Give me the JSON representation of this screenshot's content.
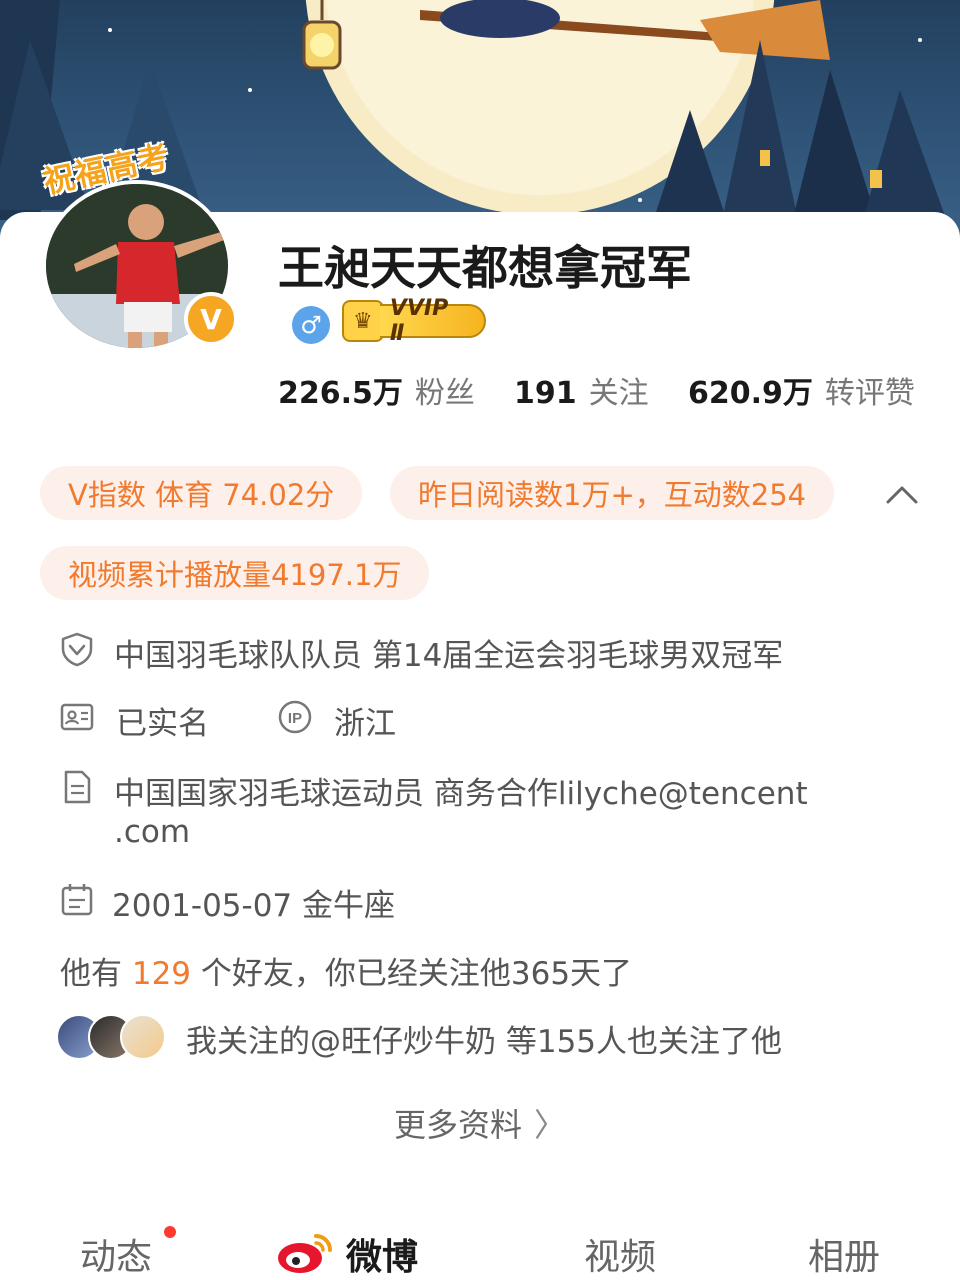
{
  "profile": {
    "avatar_caption": "祝福高考",
    "verified_badge": "V",
    "name": "王昶天天都想拿冠军",
    "gender_icon": "male-symbol-icon",
    "gender_symbol": "♂",
    "vip_label": "VVIP Ⅱ"
  },
  "stats": {
    "fans": {
      "value": "226.5万",
      "label": "粉丝"
    },
    "following": {
      "value": "191",
      "label": "关注"
    },
    "interactions": {
      "value": "620.9万",
      "label": "转评赞"
    }
  },
  "pills": {
    "v_index": "V指数 体育 74.02分",
    "yesterday": "昨日阅读数1万+，互动数254",
    "video": "视频累计播放量4197.1万"
  },
  "info": {
    "title": "中国羽毛球队队员 第14届全运会羽毛球男双冠军",
    "real_name": "已实名",
    "ip_label": "IP",
    "ip_location": "浙江",
    "bio_line1": "中国国家羽毛球运动员 商务合作lilyche@tencent",
    "bio_line2": ".com",
    "birthday": "2001-05-07 金牛座"
  },
  "friends": {
    "prefix": "他有",
    "count": "129",
    "suffix": "个好友，你已经关注他365天了"
  },
  "mutual": {
    "text": "我关注的@旺仔炒牛奶 等155人也关注了他"
  },
  "more": {
    "label": "更多资料"
  },
  "tabs": [
    "动态",
    "微博",
    "视频",
    "相册"
  ],
  "colors": {
    "accent": "#f07a2e",
    "pill_bg": "#fdf0ea",
    "verified": "#f5a623",
    "male": "#5ba4ea",
    "notify_dot": "#ff3b30"
  }
}
